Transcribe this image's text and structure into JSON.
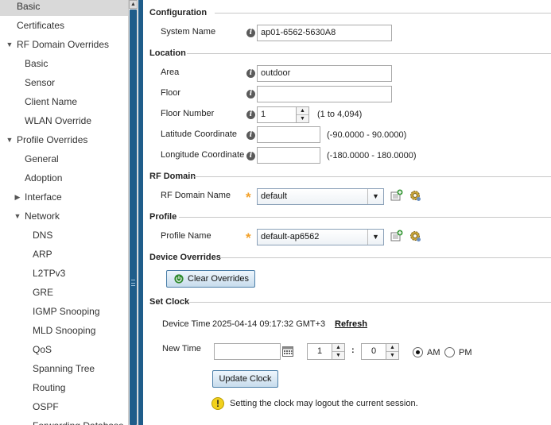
{
  "sidebar": {
    "items": [
      {
        "label": "Basic",
        "selected": true
      },
      {
        "label": "Certificates"
      },
      {
        "label": "RF Domain Overrides",
        "expander": "expanded"
      },
      {
        "label": "Basic"
      },
      {
        "label": "Sensor"
      },
      {
        "label": "Client Name"
      },
      {
        "label": "WLAN Override"
      },
      {
        "label": "Profile Overrides",
        "expander": "expanded"
      },
      {
        "label": "General"
      },
      {
        "label": "Adoption"
      },
      {
        "label": "Interface",
        "expander": "collapsed"
      },
      {
        "label": "Network",
        "expander": "expanded"
      },
      {
        "label": "DNS"
      },
      {
        "label": "ARP"
      },
      {
        "label": "L2TPv3"
      },
      {
        "label": "GRE"
      },
      {
        "label": "IGMP Snooping"
      },
      {
        "label": "MLD Snooping"
      },
      {
        "label": "QoS"
      },
      {
        "label": "Spanning Tree"
      },
      {
        "label": "Routing"
      },
      {
        "label": "OSPF"
      },
      {
        "label": "Forwarding Database"
      }
    ]
  },
  "configuration": {
    "title": "Configuration",
    "system_name_label": "System Name",
    "system_name_value": "ap01-6562-5630A8"
  },
  "location": {
    "title": "Location",
    "area_label": "Area",
    "area_value": "outdoor",
    "floor_label": "Floor",
    "floor_value": "",
    "floor_number_label": "Floor Number",
    "floor_number_value": "1",
    "floor_number_range": "(1 to 4,094)",
    "latitude_label": "Latitude Coordinate",
    "latitude_value": "",
    "latitude_range": "(-90.0000 - 90.0000)",
    "longitude_label": "Longitude Coordinate",
    "longitude_value": "",
    "longitude_range": "(-180.0000 - 180.0000)"
  },
  "rf_domain": {
    "title": "RF Domain",
    "name_label": "RF Domain Name",
    "name_value": "default"
  },
  "profile": {
    "title": "Profile",
    "name_label": "Profile Name",
    "name_value": "default-ap6562"
  },
  "device_overrides": {
    "title": "Device Overrides",
    "clear_button": "Clear Overrides"
  },
  "set_clock": {
    "title": "Set Clock",
    "device_time_label": "Device Time",
    "device_time_value": "2025-04-14 09:17:32 GMT+3",
    "refresh_link": "Refresh",
    "new_time_label": "New  Time",
    "date_value": "",
    "hour_value": "1",
    "separator": ":",
    "minute_value": "0",
    "am_label": "AM",
    "pm_label": "PM",
    "am_selected": true,
    "update_button": "Update Clock",
    "warning_text": "Setting the clock may logout the current session."
  },
  "colors": {
    "accent": "#1f5d8a",
    "required_star": "#f3a12a",
    "selected_row": "#d9d9d9"
  },
  "icons": {
    "info": "info-icon",
    "calendar": "calendar-icon",
    "warning": "warning-icon",
    "power": "power-icon",
    "create": "create-icon",
    "edit": "gear-icon"
  }
}
